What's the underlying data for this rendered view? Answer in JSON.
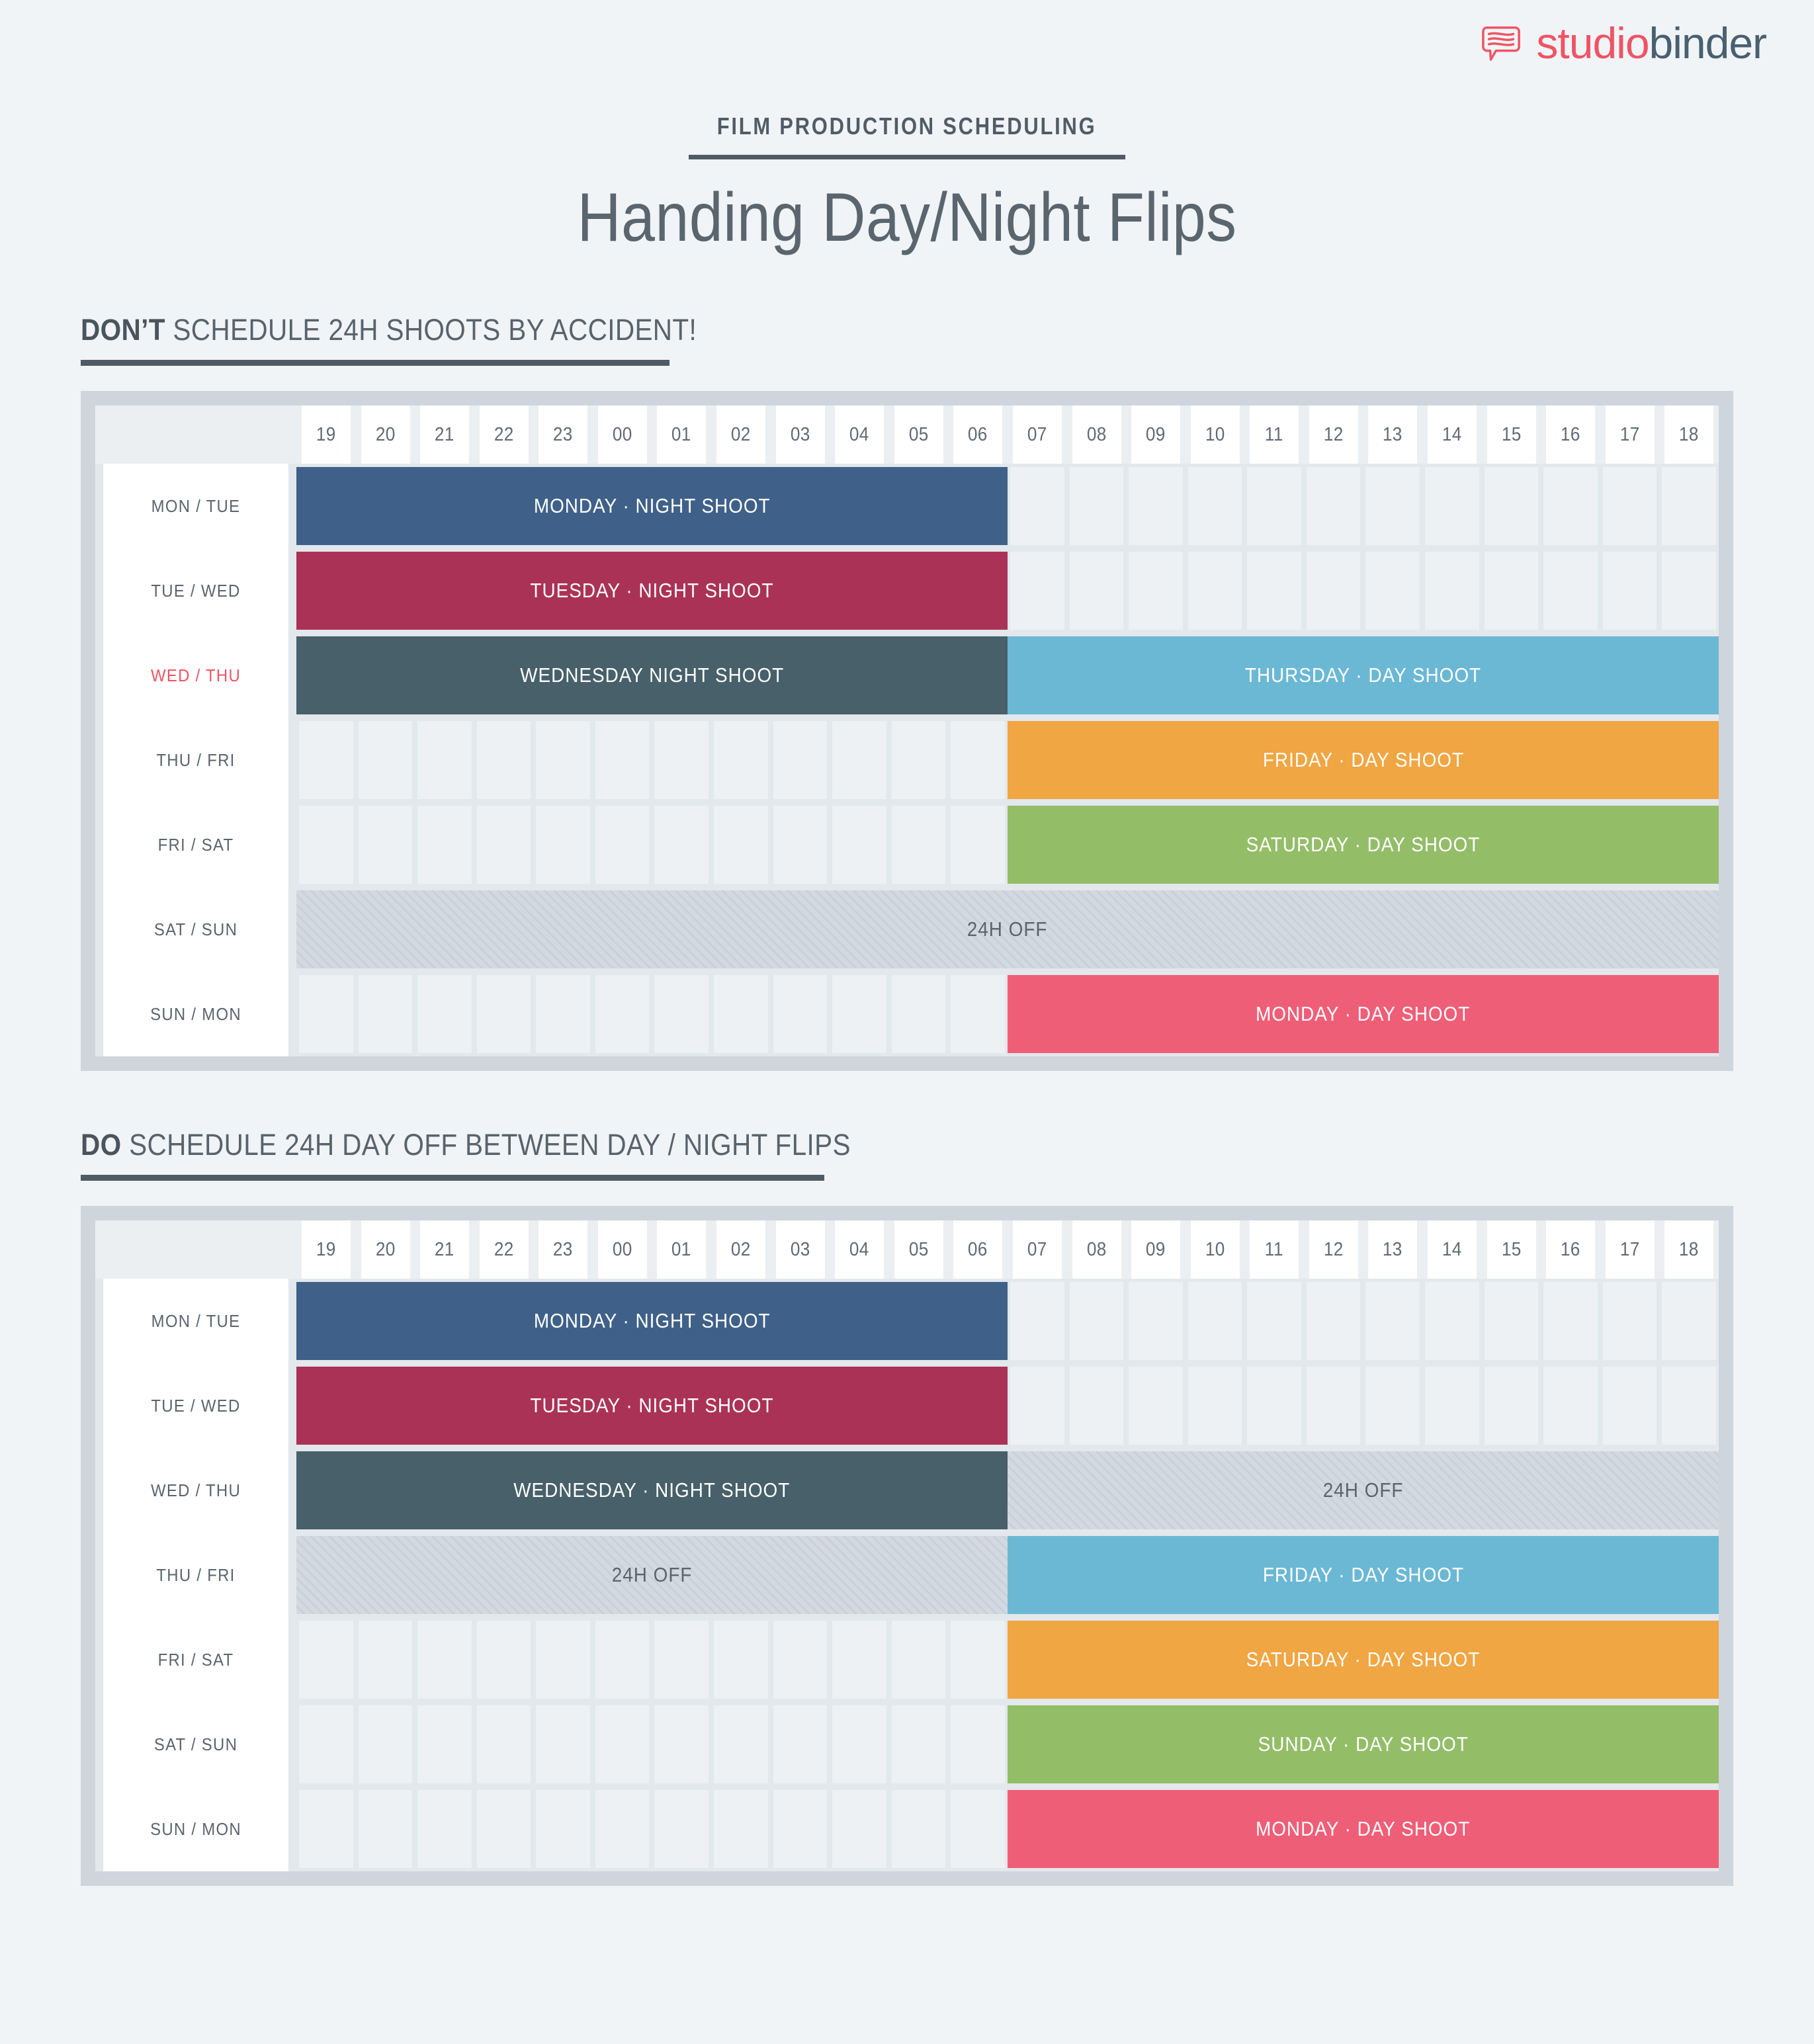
{
  "brand": {
    "logo_icon": "speech-bubble-icon",
    "name_part_1": "studio",
    "name_part_2": "binder",
    "color_accent": "#ef5464",
    "color_dark": "#48606f"
  },
  "header": {
    "eyebrow": "FILM PRODUCTION SCHEDULING",
    "title": "Handing Day/Night Flips"
  },
  "hours": [
    "19",
    "20",
    "21",
    "22",
    "23",
    "00",
    "01",
    "02",
    "03",
    "04",
    "05",
    "06",
    "07",
    "08",
    "09",
    "10",
    "11",
    "12",
    "13",
    "14",
    "15",
    "16",
    "17",
    "18"
  ],
  "sections": [
    {
      "heading_bold": "DON’T",
      "heading_rest": " SCHEDULE 24H SHOOTS BY ACCIDENT!",
      "rows": [
        {
          "label": "MON / TUE",
          "label_alert": false,
          "bars": [
            {
              "text": "MONDAY · NIGHT SHOOT",
              "start": 0,
              "span": 12,
              "color": "#3f6189",
              "kind": "shoot"
            }
          ]
        },
        {
          "label": "TUE / WED",
          "label_alert": false,
          "bars": [
            {
              "text": "TUESDAY · NIGHT SHOOT",
              "start": 0,
              "span": 12,
              "color": "#ab3257",
              "kind": "shoot"
            }
          ]
        },
        {
          "label": "WED / THU",
          "label_alert": true,
          "bars": [
            {
              "text": "WEDNESDAY NIGHT SHOOT",
              "start": 0,
              "span": 12,
              "color": "#476069",
              "kind": "shoot"
            },
            {
              "text": "THURSDAY · DAY SHOOT",
              "start": 12,
              "span": 12,
              "color": "#6bb8d5",
              "kind": "shoot"
            }
          ]
        },
        {
          "label": "THU / FRI",
          "label_alert": false,
          "bars": [
            {
              "text": "FRIDAY · DAY SHOOT",
              "start": 12,
              "span": 12,
              "color": "#f0a643",
              "kind": "shoot"
            }
          ]
        },
        {
          "label": "FRI / SAT",
          "label_alert": false,
          "bars": [
            {
              "text": "SATURDAY · DAY SHOOT",
              "start": 12,
              "span": 12,
              "color": "#94bd68",
              "kind": "shoot"
            }
          ]
        },
        {
          "label": "SAT / SUN",
          "label_alert": false,
          "bars": [
            {
              "text": "24H OFF",
              "start": 0,
              "span": 24,
              "color": "",
              "kind": "off"
            }
          ]
        },
        {
          "label": "SUN / MON",
          "label_alert": false,
          "bars": [
            {
              "text": "MONDAY · DAY SHOOT",
              "start": 12,
              "span": 12,
              "color": "#ef5e77",
              "kind": "shoot"
            }
          ]
        }
      ]
    },
    {
      "heading_bold": "DO",
      "heading_rest": " SCHEDULE 24H DAY OFF BETWEEN DAY / NIGHT FLIPS",
      "rows": [
        {
          "label": "MON / TUE",
          "label_alert": false,
          "bars": [
            {
              "text": "MONDAY · NIGHT SHOOT",
              "start": 0,
              "span": 12,
              "color": "#3f6189",
              "kind": "shoot"
            }
          ]
        },
        {
          "label": "TUE / WED",
          "label_alert": false,
          "bars": [
            {
              "text": "TUESDAY · NIGHT SHOOT",
              "start": 0,
              "span": 12,
              "color": "#ab3257",
              "kind": "shoot"
            }
          ]
        },
        {
          "label": "WED / THU",
          "label_alert": false,
          "bars": [
            {
              "text": "WEDNESDAY · NIGHT SHOOT",
              "start": 0,
              "span": 12,
              "color": "#476069",
              "kind": "shoot"
            },
            {
              "text": "24H OFF",
              "start": 12,
              "span": 12,
              "color": "",
              "kind": "off"
            }
          ]
        },
        {
          "label": "THU / FRI",
          "label_alert": false,
          "bars": [
            {
              "text": "24H OFF",
              "start": 0,
              "span": 12,
              "color": "",
              "kind": "off"
            },
            {
              "text": "FRIDAY · DAY SHOOT",
              "start": 12,
              "span": 12,
              "color": "#6bb8d5",
              "kind": "shoot"
            }
          ]
        },
        {
          "label": "FRI / SAT",
          "label_alert": false,
          "bars": [
            {
              "text": "SATURDAY · DAY SHOOT",
              "start": 12,
              "span": 12,
              "color": "#f0a643",
              "kind": "shoot"
            }
          ]
        },
        {
          "label": "SAT / SUN",
          "label_alert": false,
          "bars": [
            {
              "text": "SUNDAY · DAY SHOOT",
              "start": 12,
              "span": 12,
              "color": "#94bd68",
              "kind": "shoot"
            }
          ]
        },
        {
          "label": "SUN / MON",
          "label_alert": false,
          "bars": [
            {
              "text": "MONDAY · DAY SHOOT",
              "start": 12,
              "span": 12,
              "color": "#ef5e77",
              "kind": "shoot"
            }
          ]
        }
      ]
    }
  ]
}
